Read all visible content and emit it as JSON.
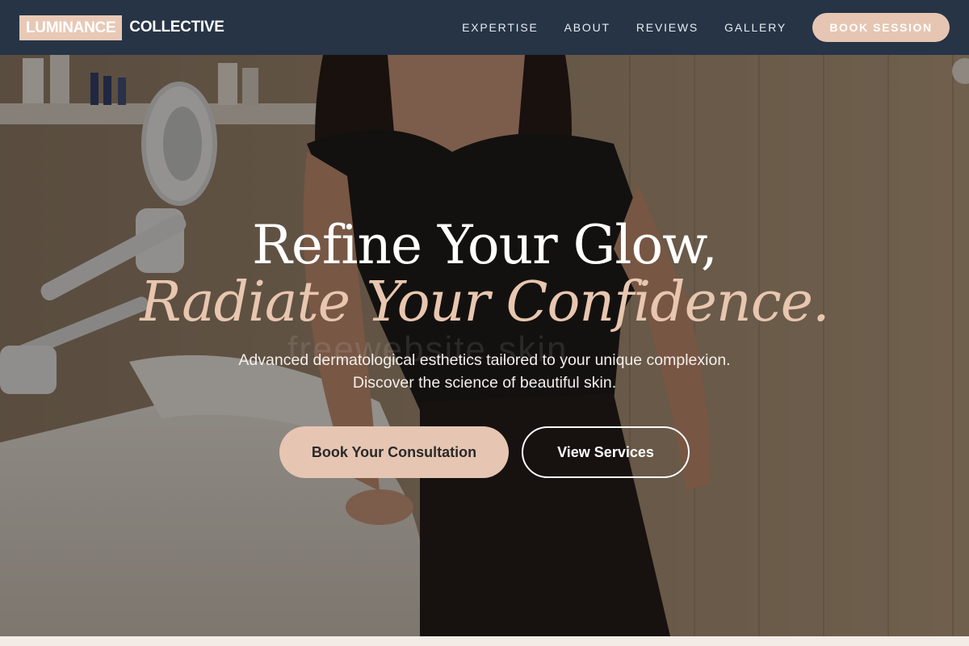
{
  "header": {
    "logo_box": "LUMINANCE",
    "logo_text": "COLLECTIVE",
    "nav": [
      "EXPERTISE",
      "ABOUT",
      "REVIEWS",
      "GALLERY"
    ],
    "cta": "BOOK SESSION"
  },
  "hero": {
    "headline_line1": "Refine Your Glow,",
    "headline_line2": "Radiate Your Confidence.",
    "subtext_line1": "Advanced dermatological esthetics tailored to your unique complexion.",
    "subtext_line2": "Discover the science of beautiful skin.",
    "primary_button": "Book Your Consultation",
    "secondary_button": "View Services",
    "watermark": "freewebsite.skin"
  },
  "colors": {
    "header_bg": "#263445",
    "accent": "#e6c6b2",
    "headline_accent": "#e8c6af"
  },
  "icons": [
    "magnifier-lamp-icon"
  ]
}
